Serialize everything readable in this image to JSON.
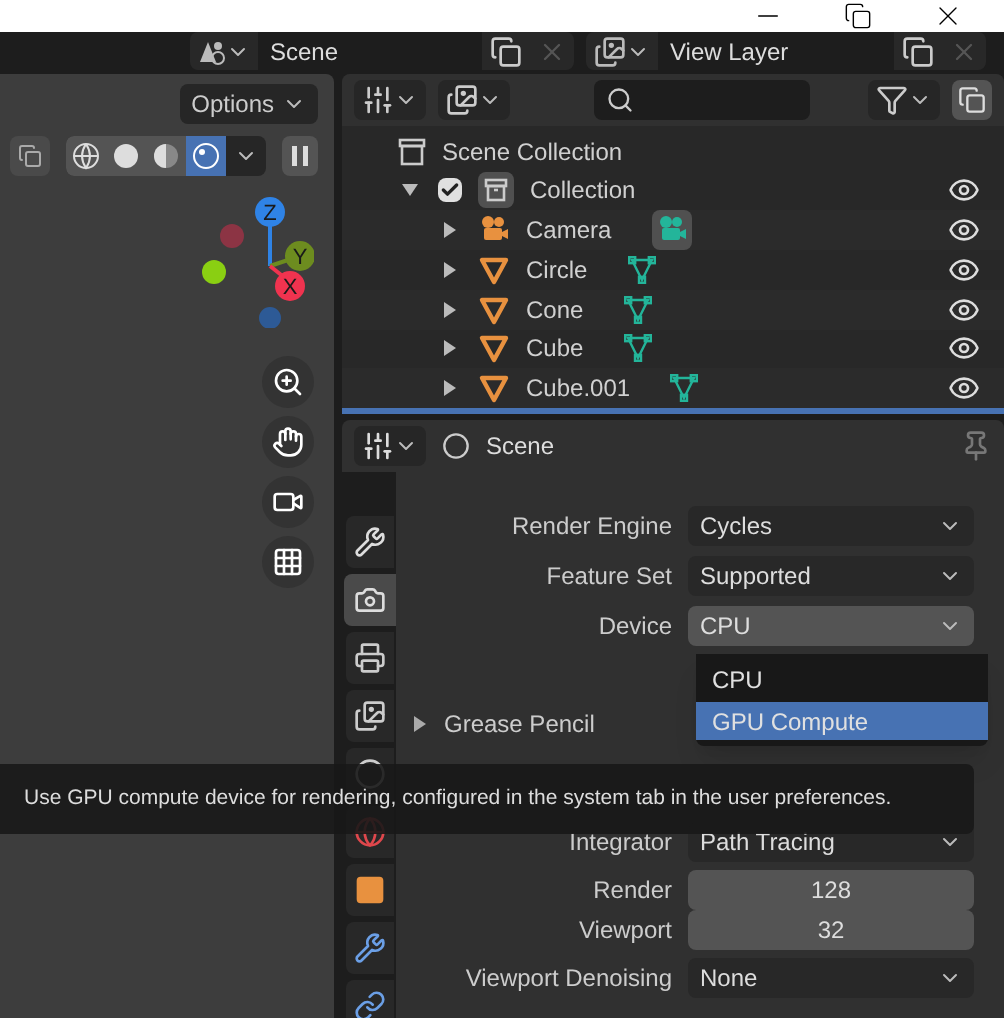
{
  "topbar": {
    "scene": "Scene",
    "view_layer": "View Layer"
  },
  "viewport": {
    "options": "Options",
    "shading_modes": [
      {
        "kind": "wireframe",
        "selected": false
      },
      {
        "kind": "solid",
        "selected": false
      },
      {
        "kind": "material",
        "selected": false
      },
      {
        "kind": "rendered",
        "selected": true
      }
    ],
    "axes": [
      {
        "label": "Z",
        "color": "#2f83e6"
      },
      {
        "label": "Y",
        "color": "#6d8c1f"
      },
      {
        "label": "X",
        "color": "#f0334f"
      }
    ]
  },
  "outliner": {
    "root": "Scene Collection",
    "tree": [
      {
        "name": "Collection",
        "kind": "collection",
        "checked": true,
        "expanded": true,
        "children": [
          {
            "name": "Camera",
            "kind": "camera",
            "expanded": false
          },
          {
            "name": "Circle",
            "kind": "mesh",
            "expanded": false
          },
          {
            "name": "Cone",
            "kind": "mesh",
            "expanded": false
          },
          {
            "name": "Cube",
            "kind": "mesh",
            "expanded": false
          },
          {
            "name": "Cube.001",
            "kind": "mesh",
            "expanded": false
          }
        ]
      }
    ]
  },
  "properties": {
    "title": "Scene",
    "tabs": [
      {
        "kind": "tool",
        "selected": false
      },
      {
        "kind": "render",
        "selected": true
      },
      {
        "kind": "output",
        "selected": false
      },
      {
        "kind": "view_layer",
        "selected": false
      },
      {
        "kind": "scene",
        "selected": false
      },
      {
        "kind": "world",
        "selected": false
      },
      {
        "kind": "object",
        "selected": false
      },
      {
        "kind": "modifiers",
        "selected": false
      },
      {
        "kind": "constraints",
        "selected": false
      }
    ],
    "fields": [
      {
        "label": "Render Engine",
        "value": "Cycles",
        "kind": "dropdown",
        "active": false
      },
      {
        "label": "Feature Set",
        "value": "Supported",
        "kind": "dropdown",
        "active": false
      },
      {
        "label": "Device",
        "value": "CPU",
        "kind": "dropdown",
        "active": true
      }
    ],
    "section": {
      "title": "Grease Pencil",
      "expanded": false
    },
    "fields2": [
      {
        "label": "Integrator",
        "value": "Path Tracing",
        "kind": "dropdown",
        "active": false
      },
      {
        "label": "Render",
        "value": "128",
        "kind": "number",
        "active": false
      },
      {
        "label": "Viewport",
        "value": "32",
        "kind": "number",
        "active": false
      },
      {
        "label": "Viewport Denoising",
        "value": "None",
        "kind": "dropdown",
        "active": false
      }
    ],
    "menu": [
      {
        "label": "CPU",
        "selected": false
      },
      {
        "label": "GPU Compute",
        "selected": true
      }
    ],
    "tooltip": "Use GPU compute device for rendering, configured in the system tab in the user preferences."
  }
}
